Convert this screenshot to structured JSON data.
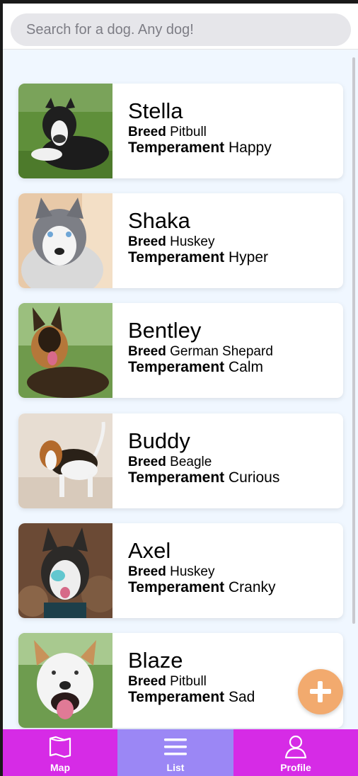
{
  "search": {
    "placeholder": "Search for a dog. Any dog!"
  },
  "labels": {
    "breed": "Breed",
    "temperament": "Temperament"
  },
  "dogs": [
    {
      "name": "Stella",
      "breed": "Pitbull",
      "temperament": "Happy"
    },
    {
      "name": "Shaka",
      "breed": "Huskey",
      "temperament": "Hyper"
    },
    {
      "name": "Bentley",
      "breed": "German Shepard",
      "temperament": "Calm"
    },
    {
      "name": "Buddy",
      "breed": "Beagle",
      "temperament": "Curious"
    },
    {
      "name": "Axel",
      "breed": "Huskey",
      "temperament": "Cranky"
    },
    {
      "name": "Blaze",
      "breed": "Pitbull",
      "temperament": "Sad"
    }
  ],
  "fab": {
    "icon": "plus-icon",
    "color": "#f2aa6e"
  },
  "tabs": [
    {
      "label": "Map",
      "icon": "map-icon"
    },
    {
      "label": "List",
      "icon": "list-icon",
      "active": true
    },
    {
      "label": "Profile",
      "icon": "user-icon"
    }
  ],
  "colors": {
    "tabbar": "#d62be6",
    "tab_active": "#9b87f5",
    "background": "#f0f7ff"
  }
}
